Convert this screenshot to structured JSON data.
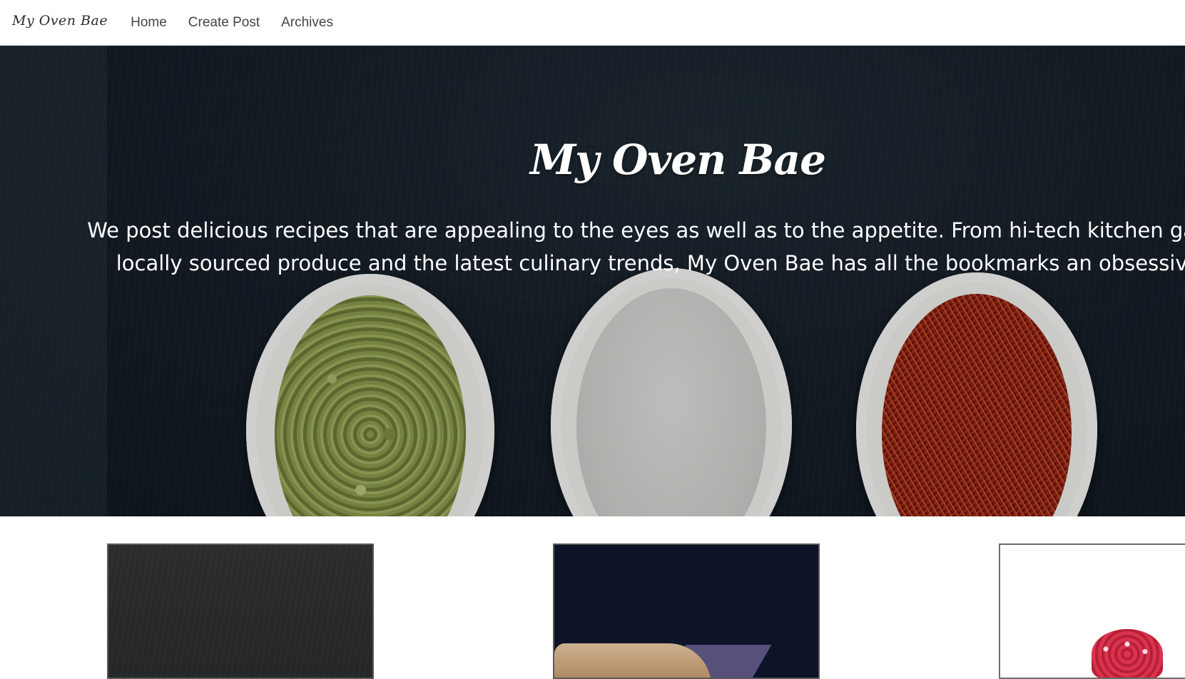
{
  "nav": {
    "brand": "My Oven Bae",
    "links": [
      {
        "label": "Home"
      },
      {
        "label": "Create Post"
      },
      {
        "label": "Archives"
      }
    ]
  },
  "hero": {
    "title": "My Oven Bae",
    "text_line1": "We post delicious recipes that are appealing to the eyes as well as to the appetite. From hi-tech kitchen gadgets t",
    "text_line2": "locally sourced produce and the latest culinary trends, My Oven Bae has all the bookmarks an obsessive foo"
  },
  "colors": {
    "hero_bg": "#17202a",
    "text_light": "#ffffff",
    "nav_text": "#444444"
  }
}
